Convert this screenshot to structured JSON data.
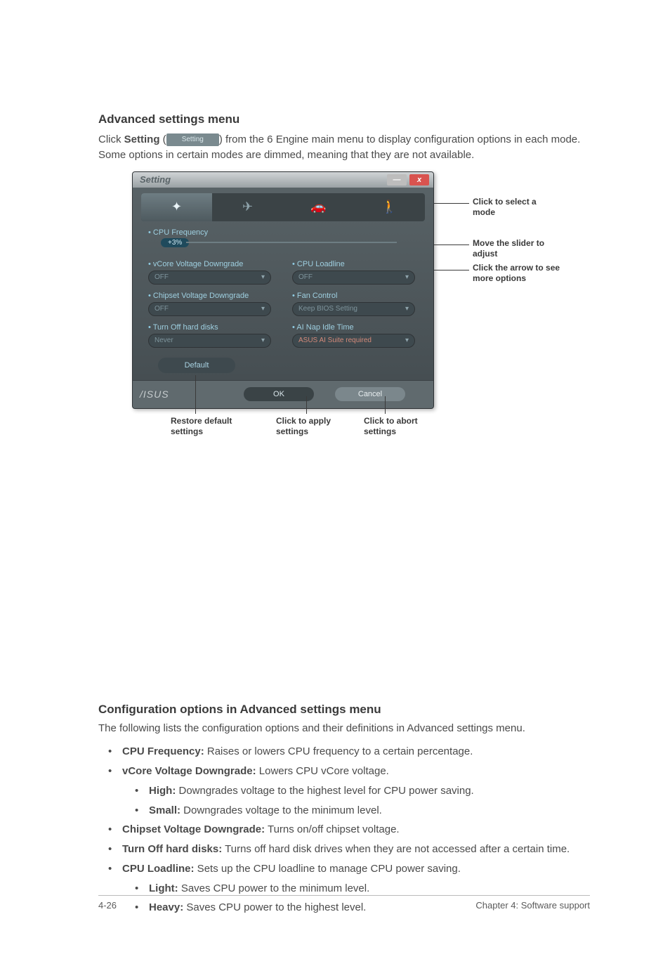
{
  "heading1": "Advanced settings menu",
  "intro_prefix": "Click ",
  "intro_bold": "Setting",
  "intro_paren_open": " (",
  "intro_button_label": "Setting",
  "intro_paren_close": ") ",
  "intro_rest": "from the 6 Engine main menu to display configuration options in each mode. Some options in certain modes are dimmed, meaning that they are not available.",
  "window": {
    "title": "Setting",
    "close": "x",
    "min": "—",
    "cpu_freq_label": "CPU Frequency",
    "cpu_freq_value": "+3%",
    "left": {
      "vcore_label": "vCore Voltage Downgrade",
      "vcore_value": "OFF",
      "chipset_label": "Chipset Voltage Downgrade",
      "chipset_value": "OFF",
      "turnoff_label": "Turn Off hard disks",
      "turnoff_value": "Never"
    },
    "right": {
      "loadline_label": "CPU Loadline",
      "loadline_value": "OFF",
      "fan_label": "Fan Control",
      "fan_value": "Keep BIOS Setting",
      "ainap_label": "AI Nap Idle Time",
      "ainap_value": "ASUS AI Suite required"
    },
    "default_btn": "Default",
    "ok": "OK",
    "cancel": "Cancel",
    "logo": "/ISUS"
  },
  "callouts": {
    "select_mode": "Click to select a mode",
    "slider": "Move the slider to adjust",
    "arrow": "Click the arrow to see more options",
    "restore": "Restore default settings",
    "apply": "Click to apply settings",
    "abort": "Click to abort settings"
  },
  "heading2": "Configuration options in Advanced settings menu",
  "para2": "The following lists the configuration options and their definitions in Advanced settings menu.",
  "opts": {
    "cpu_freq_b": "CPU Frequency:",
    "cpu_freq_t": " Raises or lowers CPU frequency to a certain percentage.",
    "vcore_b": "vCore Voltage Downgrade:",
    "vcore_t": " Lowers CPU vCore voltage.",
    "high_b": "High:",
    "high_t": " Downgrades voltage to the highest level for CPU power saving.",
    "small_b": "Small:",
    "small_t": " Downgrades voltage to the minimum level.",
    "chipset_b": "Chipset Voltage Downgrade:",
    "chipset_t": " Turns on/off chipset voltage.",
    "turnoff_b": "Turn Off hard disks:",
    "turnoff_t": " Turns off hard disk drives when they are not accessed after a certain time.",
    "loadline_b": "CPU Loadline:",
    "loadline_t": " Sets up the CPU loadline to manage CPU power saving.",
    "light_b": "Light:",
    "light_t": " Saves CPU power to the minimum level.",
    "heavy_b": "Heavy:",
    "heavy_t": " Saves CPU power to the highest level."
  },
  "footer": {
    "left": "4-26",
    "right": "Chapter 4: Software support"
  }
}
